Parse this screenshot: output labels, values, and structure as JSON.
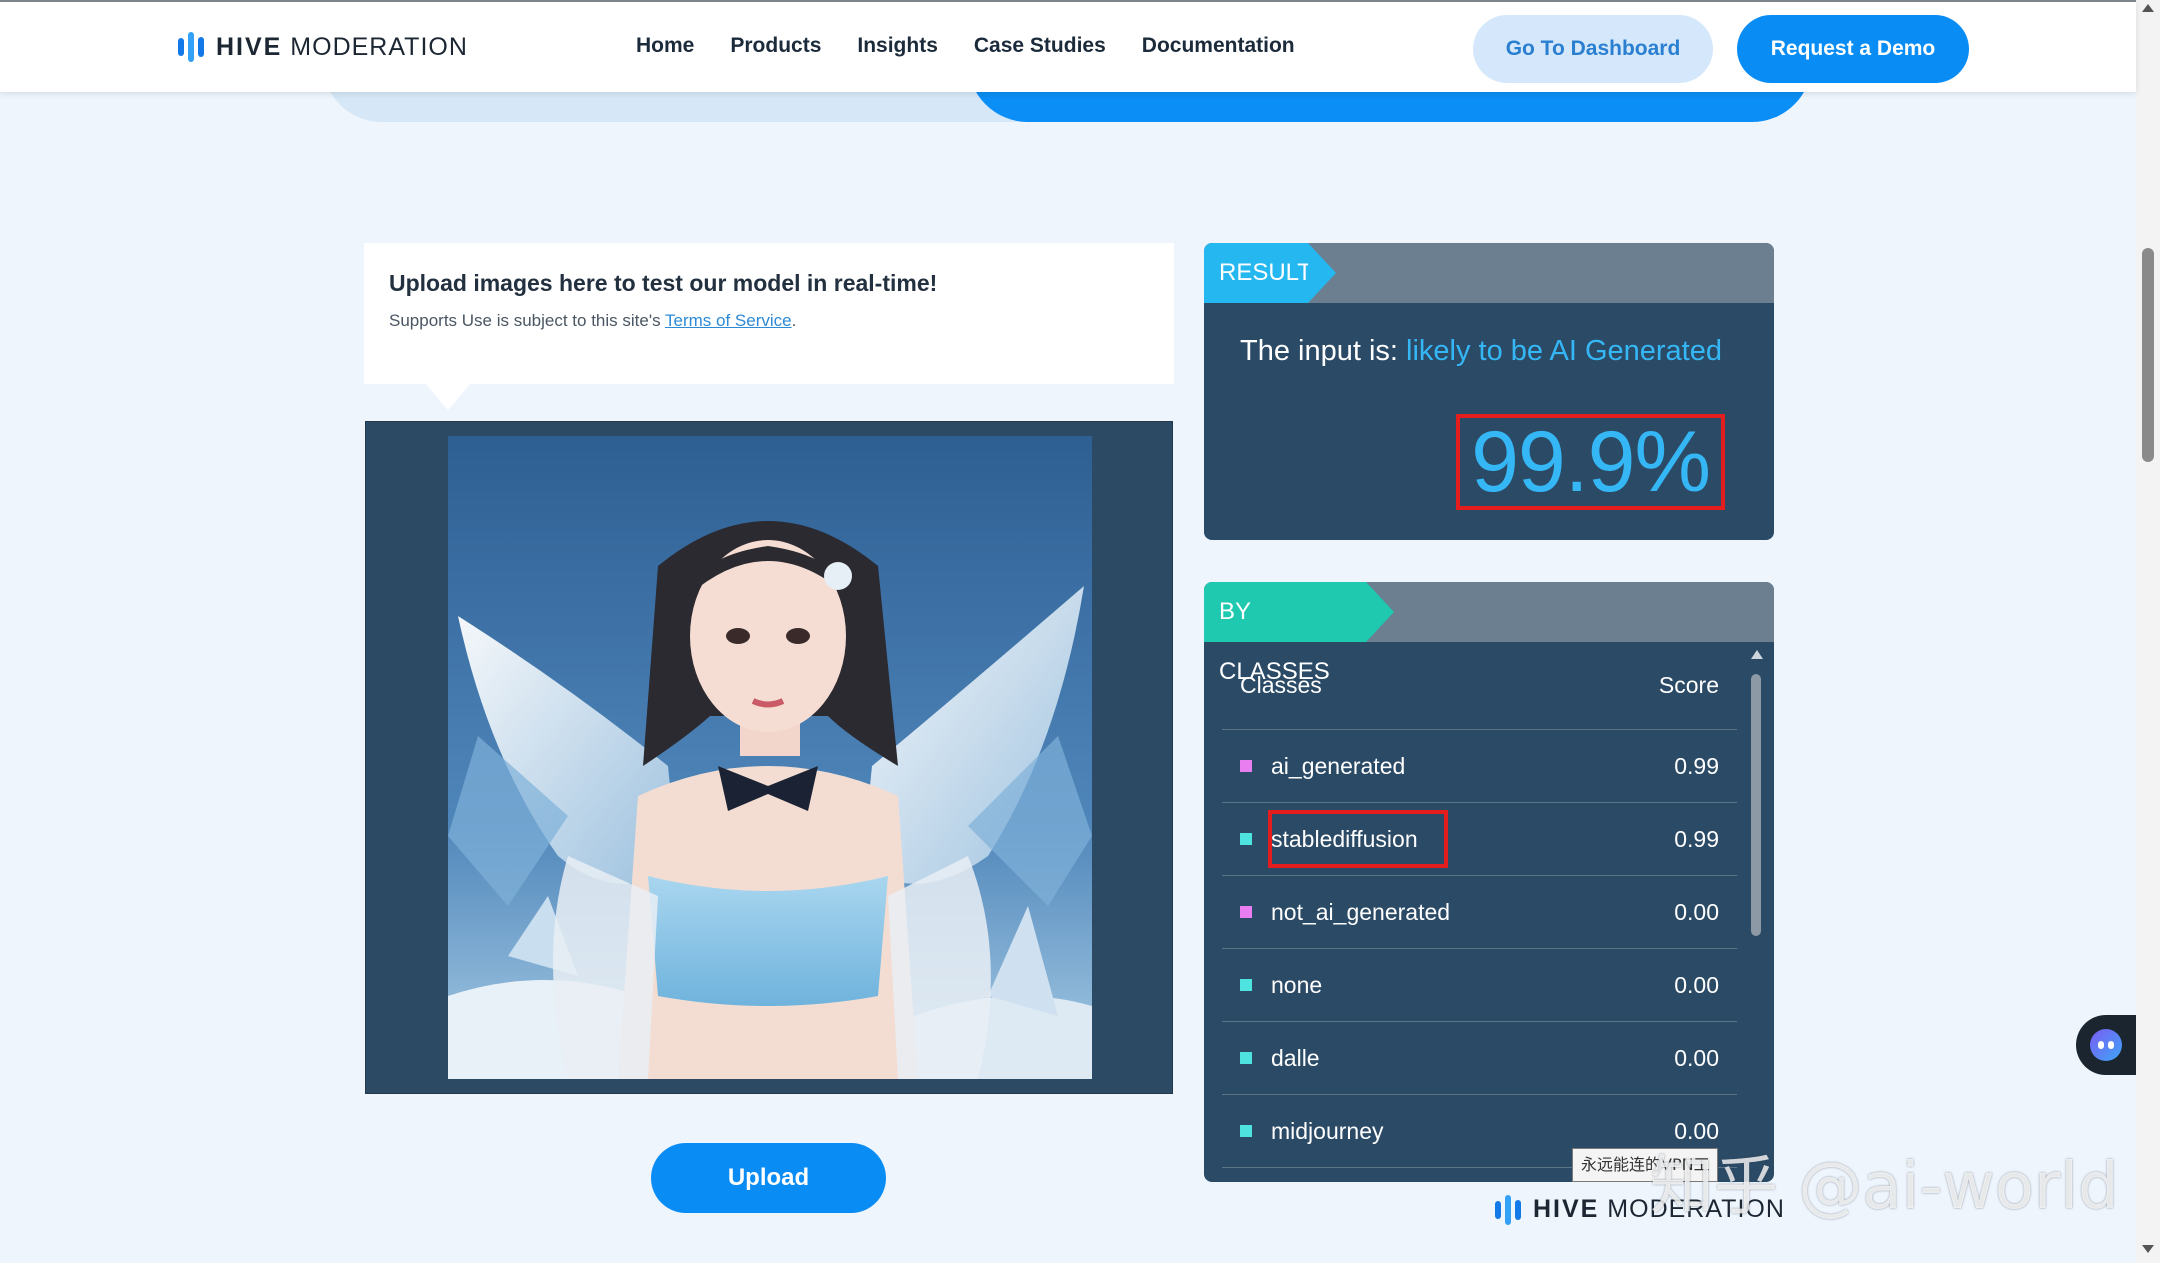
{
  "header": {
    "logo_bold": "HIVE",
    "logo_light": " MODERATION",
    "nav": [
      "Home",
      "Products",
      "Insights",
      "Case Studies",
      "Documentation"
    ],
    "dashboard_label": "Go To Dashboard",
    "demo_label": "Request a Demo"
  },
  "upload": {
    "title": "Upload images here to test our model in real-time!",
    "subtitle_prefix": "Supports  Use is subject to this site's ",
    "terms_link": "Terms of Service",
    "subtitle_suffix": ".",
    "button_label": "Upload"
  },
  "result": {
    "tag": "RESULT",
    "prefix": "The input is: ",
    "verdict": "likely to be AI Generated",
    "percentage": "99.9%"
  },
  "classes": {
    "tag": "BY CLASSES",
    "col_classes": "Classes",
    "col_score": "Score",
    "rows": [
      {
        "name": "ai_generated",
        "score": "0.99",
        "color": "#e87ef0"
      },
      {
        "name": "stablediffusion",
        "score": "0.99",
        "color": "#4fe3e0"
      },
      {
        "name": "not_ai_generated",
        "score": "0.00",
        "color": "#e87ef0"
      },
      {
        "name": "none",
        "score": "0.00",
        "color": "#4fe3e0"
      },
      {
        "name": "dalle",
        "score": "0.00",
        "color": "#4fe3e0"
      },
      {
        "name": "midjourney",
        "score": "0.00",
        "color": "#4fe3e0"
      }
    ]
  },
  "footer": {
    "logo_bold": "HIVE",
    "logo_light": " MODERATION"
  },
  "overlay": {
    "badge": "永远能连的VPN工",
    "watermark": "知乎 @ai-world"
  },
  "colors": {
    "accent": "#0a8cf5",
    "panel": "#2b4a66",
    "highlight": "#35b7f6",
    "annotation": "#e41e1e"
  }
}
